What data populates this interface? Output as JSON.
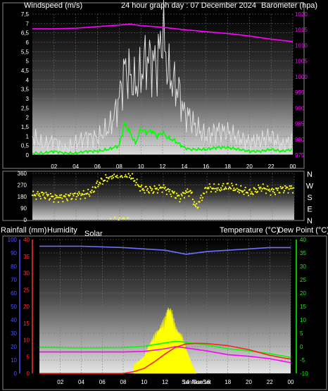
{
  "header": {
    "wind_label": "Windspeed (m/s)",
    "title": "24 hour graph day : 07 December 2024",
    "baro_label": "Barometer (hpa)"
  },
  "labels": {
    "rain": "Rainfall (mm)",
    "humidity": "Humidity",
    "solar": "Solar",
    "temperature": "Temperature (°C)",
    "dewpoint": "Dew Point (°C)",
    "sunrise": "SunRise",
    "sunset": "SunSet"
  },
  "colors": {
    "gust": "#e0e0e0",
    "wind": "#00ff00",
    "baro": "#ff00ff",
    "direction": "#ffff00",
    "humidity": "#7070ff",
    "temperature": "#ff00ff",
    "dewpoint": "#00ff00",
    "rain": "#ff2020",
    "solar": "#ffff00",
    "rain_axis": "#ff3030",
    "humidity_axis": "#5050ff",
    "temp_axis": "#00ff00"
  },
  "chart_data": [
    {
      "type": "line",
      "title": "24 hour graph day : 07 December 2024",
      "x_ticks": [
        "02",
        "04",
        "06",
        "08",
        "10",
        "12",
        "14",
        "16",
        "18",
        "20",
        "22",
        "00"
      ],
      "y_left": {
        "label": "Windspeed (m/s)",
        "ylim": [
          0,
          7.5
        ],
        "ticks": [
          "0",
          "0,5",
          "1",
          "1,5",
          "2",
          "2,5",
          "3",
          "3,5",
          "4",
          "4,5",
          "5",
          "5,5",
          "6",
          "6,5",
          "7",
          "7,5"
        ]
      },
      "y_right": {
        "label": "Barometer (hpa)",
        "ylim": [
          975,
          1020
        ],
        "ticks": [
          "975",
          "980",
          "985",
          "990",
          "995",
          "1000",
          "1005",
          "1010",
          "1015",
          "1020"
        ]
      },
      "series": [
        {
          "key": "gust",
          "axis": "left",
          "x": [
            0,
            1,
            2,
            3,
            4,
            5,
            6,
            7,
            7.5,
            8,
            8.5,
            9,
            9.5,
            10,
            10.5,
            11,
            11.5,
            12,
            12.5,
            13,
            13.5,
            14,
            14.5,
            15,
            16,
            17,
            18,
            19,
            20,
            21,
            22,
            23,
            24
          ],
          "values": [
            1.0,
            0.5,
            0.8,
            0.3,
            0.6,
            1.0,
            0.9,
            1.4,
            2.0,
            3.0,
            4.6,
            4.2,
            3.6,
            4.3,
            5.2,
            5.0,
            4.8,
            6.6,
            4.4,
            3.8,
            3.4,
            2.2,
            2.0,
            1.5,
            1.0,
            1.3,
            1.2,
            0.9,
            0.7,
            0.8,
            1.0,
            0.5,
            0.8
          ]
        },
        {
          "key": "wind",
          "axis": "left",
          "x": [
            0,
            1,
            2,
            3,
            4,
            5,
            6,
            7,
            7.5,
            8,
            8.5,
            9,
            9.5,
            10,
            10.5,
            11,
            11.5,
            12,
            12.5,
            13,
            13.5,
            14,
            14.5,
            15,
            16,
            17,
            18,
            19,
            20,
            21,
            22,
            23,
            24
          ],
          "values": [
            0.1,
            0.1,
            0.2,
            0.1,
            0.1,
            0.2,
            0.2,
            0.3,
            0.4,
            0.5,
            1.7,
            1.2,
            0.6,
            1.4,
            1.2,
            1.3,
            1.0,
            1.2,
            0.9,
            0.8,
            0.6,
            0.4,
            0.3,
            0.3,
            0.3,
            0.4,
            0.4,
            0.3,
            0.2,
            0.2,
            0.3,
            0.2,
            0.3
          ]
        },
        {
          "key": "baro",
          "axis": "right",
          "x": [
            0,
            2,
            4,
            6,
            8,
            9,
            10,
            12,
            14,
            16,
            18,
            20,
            22,
            24
          ],
          "values": [
            1015.3,
            1015.3,
            1015.5,
            1016.0,
            1016.5,
            1016.8,
            1016.3,
            1015.8,
            1015.0,
            1014.4,
            1013.8,
            1013.0,
            1012.0,
            1011.2
          ]
        }
      ]
    },
    {
      "type": "scatter",
      "x_ticks": [
        "02",
        "04",
        "06",
        "08",
        "10",
        "12",
        "14",
        "16",
        "18",
        "20",
        "22",
        "00"
      ],
      "y_left": {
        "ylim": [
          0,
          360
        ],
        "ticks": [
          "0",
          "90",
          "180",
          "270",
          "360"
        ]
      },
      "y_right": {
        "ticks": [
          "N",
          "W",
          "S",
          "E",
          "N"
        ]
      },
      "series": [
        {
          "key": "direction",
          "x": [
            0,
            1,
            2,
            3,
            4,
            5,
            5.5,
            6,
            7,
            7.5,
            8,
            8.5,
            9,
            9.5,
            10,
            11,
            12,
            12.5,
            13,
            13.5,
            14,
            14.5,
            15,
            16,
            17,
            18,
            19,
            20,
            21,
            22,
            23,
            24
          ],
          "values": [
            190,
            195,
            170,
            175,
            190,
            200,
            220,
            280,
            330,
            345,
            345,
            350,
            340,
            290,
            240,
            230,
            250,
            220,
            200,
            170,
            210,
            220,
            90,
            250,
            240,
            260,
            230,
            210,
            250,
            220,
            240,
            245
          ]
        }
      ]
    },
    {
      "type": "line",
      "x_ticks": [
        "02",
        "04",
        "06",
        "08",
        "10",
        "12",
        "14",
        "SunRise",
        "SunSet",
        "16",
        "18",
        "20",
        "22",
        "00"
      ],
      "y_rain": {
        "label": "Rainfall (mm)",
        "ylim": [
          0,
          40
        ],
        "ticks": [
          "0",
          "5",
          "10",
          "15",
          "20",
          "25",
          "30",
          "35",
          "40"
        ]
      },
      "y_humidity": {
        "label": "Humidity",
        "ylim": [
          0,
          100
        ],
        "ticks": [
          "0",
          "10",
          "20",
          "30",
          "40",
          "50",
          "60",
          "70",
          "80",
          "90",
          "100"
        ]
      },
      "y_solar": {
        "label": "Solar"
      },
      "y_temp": {
        "label": "Temperature (°C)",
        "ylim": [
          -10,
          40
        ],
        "ticks": [
          "-10",
          "-5",
          "0",
          "5",
          "10",
          "15",
          "20",
          "25",
          "30",
          "35",
          "40"
        ]
      },
      "series": [
        {
          "key": "humidity",
          "axis": "humidity",
          "x": [
            0,
            4,
            8,
            10,
            12,
            14,
            16,
            18,
            20,
            22,
            24
          ],
          "values": [
            95,
            95,
            94,
            93,
            92,
            89,
            91,
            92,
            93,
            94,
            94
          ]
        },
        {
          "key": "dewpoint",
          "axis": "temp",
          "x": [
            0,
            4,
            8,
            10,
            12,
            13,
            14,
            16,
            18,
            20,
            22,
            24
          ],
          "values": [
            -0.3,
            -0.5,
            -0.4,
            0.1,
            1.4,
            2.0,
            1.6,
            0.6,
            -0.8,
            -1.6,
            -2.6,
            -4.0
          ]
        },
        {
          "key": "temperature",
          "axis": "temp",
          "x": [
            0,
            4,
            8,
            10,
            12,
            13,
            14,
            16,
            18,
            20,
            22,
            24
          ],
          "values": [
            -2.0,
            -2.0,
            -2.0,
            -1.8,
            -0.8,
            0.0,
            -0.5,
            -1.6,
            -3.0,
            -3.6,
            -4.5,
            -6.0
          ]
        },
        {
          "key": "rain",
          "axis": "rain",
          "x": [
            0,
            8,
            9,
            10,
            11,
            12,
            13,
            14,
            15,
            16,
            18,
            20,
            22,
            23.5,
            24
          ],
          "values": [
            0,
            0,
            0.5,
            1.5,
            3.5,
            5.8,
            7.8,
            8.8,
            9.0,
            8.9,
            8.3,
            7.1,
            5.4,
            4.5,
            4.3
          ]
        },
        {
          "key": "solar",
          "axis": "solar",
          "x": [
            9,
            9.5,
            10,
            10.5,
            11,
            11.5,
            12,
            12.3,
            12.6,
            13,
            13.3,
            13.6,
            14,
            14.3,
            14.6,
            15
          ],
          "values": [
            2,
            3,
            4,
            7,
            9,
            11,
            13,
            16,
            15,
            11,
            10,
            9,
            6,
            4,
            2,
            0
          ]
        }
      ]
    }
  ]
}
